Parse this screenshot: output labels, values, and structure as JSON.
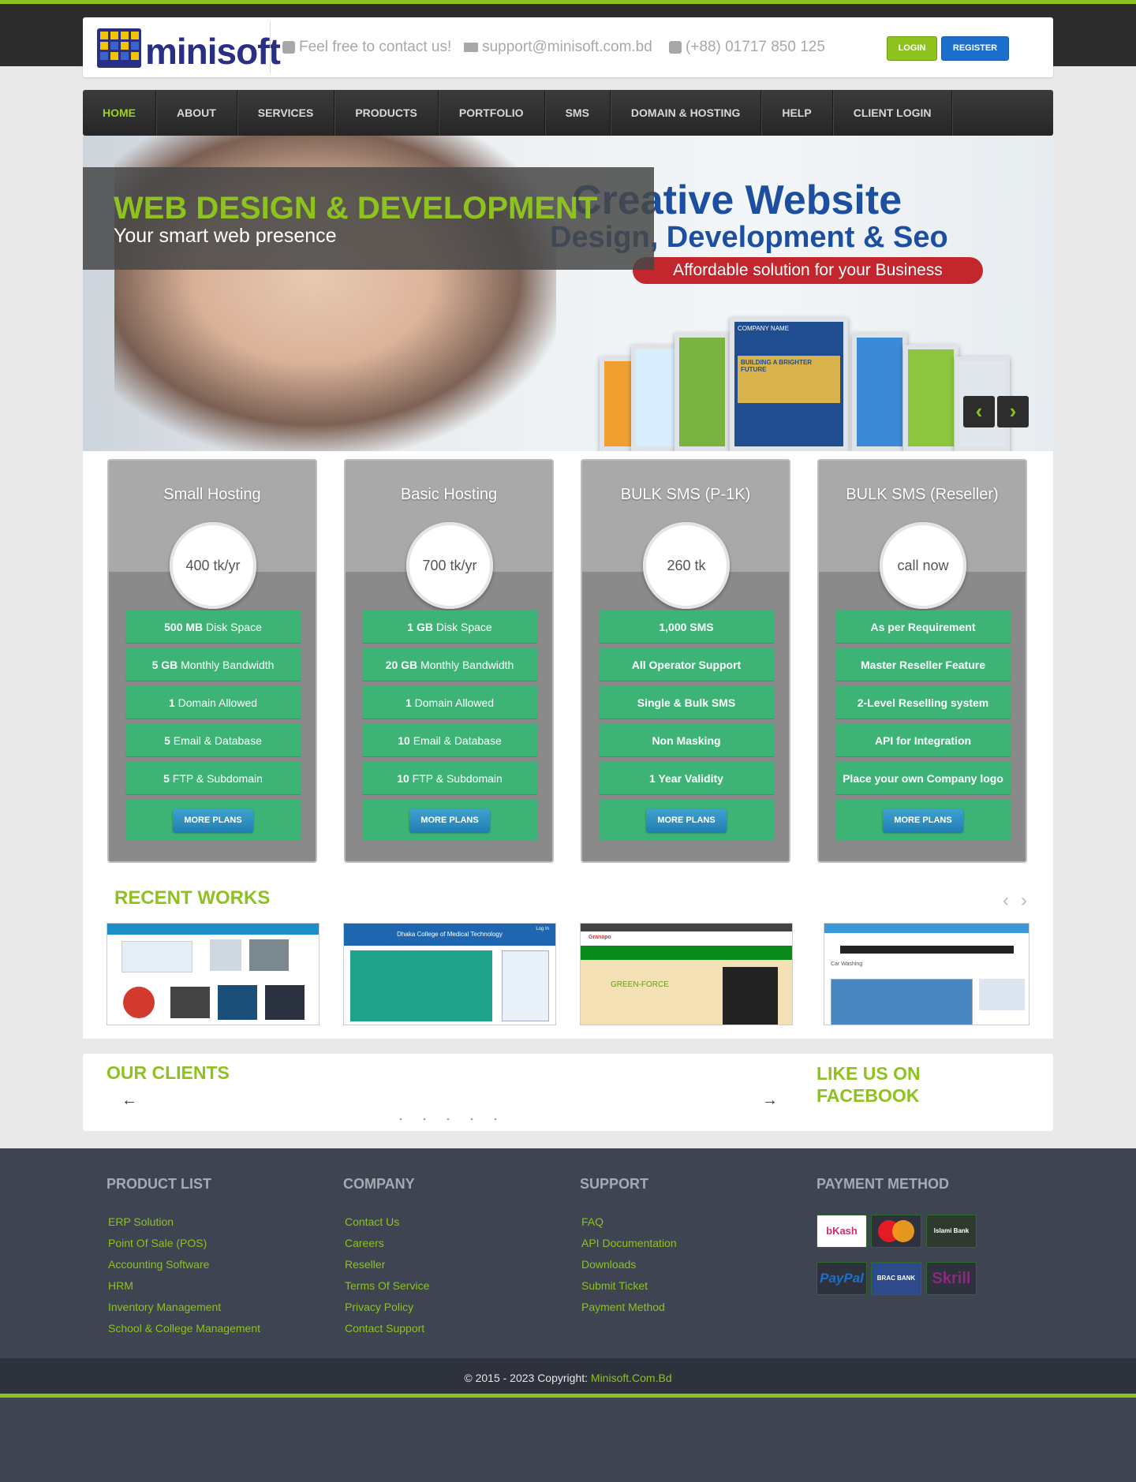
{
  "brand": {
    "name": "minisoft",
    "accent": "#8dc21f",
    "nav_bg": "#2b2b2b",
    "footer_bg": "#3e4452",
    "plan_green": "#3db475"
  },
  "header": {
    "contact_text": "Feel free to contact us!",
    "email": "support@minisoft.com.bd",
    "phone": "(+88) 01717 850 125",
    "login_label": "LOGIN",
    "register_label": "REGISTER"
  },
  "nav": {
    "items": [
      "HOME",
      "ABOUT",
      "SERVICES",
      "PRODUCTS",
      "PORTFOLIO",
      "SMS",
      "DOMAIN & HOSTING",
      "HELP",
      "CLIENT LOGIN"
    ],
    "active": "HOME"
  },
  "hero": {
    "caption_title": "WEB DESIGN & DEVELOPMENT",
    "caption_sub": "Your smart web presence",
    "banner_line1": "Creative Website",
    "banner_line2": "Design, Development & Seo",
    "banner_pill": "Affordable solution for your Business",
    "screen_text": "COMPANY NAME",
    "screen_text2": "BUILDING A BRIGHTER FUTURE",
    "prev_icon": "chevron-left-icon",
    "next_icon": "chevron-right-icon"
  },
  "plans": [
    {
      "title": "Small Hosting",
      "price": "400 tk/yr",
      "features": [
        [
          "500 MB",
          " Disk Space"
        ],
        [
          "5 GB",
          " Monthly Bandwidth"
        ],
        [
          "1",
          " Domain Allowed"
        ],
        [
          "5",
          " Email & Database"
        ],
        [
          "5",
          " FTP & Subdomain"
        ]
      ],
      "button": "MORE PLANS"
    },
    {
      "title": "Basic Hosting",
      "price": "700 tk/yr",
      "features": [
        [
          "1 GB",
          " Disk Space"
        ],
        [
          "20 GB",
          " Monthly Bandwidth"
        ],
        [
          "1",
          " Domain Allowed"
        ],
        [
          "10",
          " Email & Database"
        ],
        [
          "10",
          " FTP & Subdomain"
        ]
      ],
      "button": "MORE PLANS"
    },
    {
      "title": "BULK SMS (P-1K)",
      "price": "260 tk",
      "features": [
        [
          "1,000 SMS",
          ""
        ],
        [
          "All Operator Support",
          ""
        ],
        [
          "Single & Bulk SMS",
          ""
        ],
        [
          "Non Masking",
          ""
        ],
        [
          "1 Year Validity",
          ""
        ]
      ],
      "button": "MORE PLANS"
    },
    {
      "title": "BULK SMS (Reseller)",
      "price": "call now",
      "features": [
        [
          "As per Requirement",
          ""
        ],
        [
          "Master Reseller Feature",
          ""
        ],
        [
          "2-Level Reselling system",
          ""
        ],
        [
          "API for Integration",
          ""
        ],
        [
          "Place your own Company logo",
          ""
        ]
      ],
      "button": "MORE PLANS"
    }
  ],
  "recent_works": {
    "title": "RECENT WORKS",
    "items": [
      {
        "caption": ""
      },
      {
        "caption": "Dhaka College of Medical Technology",
        "login": "Log In"
      },
      {
        "caption": "GREEN-FORCE",
        "brand": "Granapo"
      },
      {
        "caption": "Car Washing"
      }
    ]
  },
  "clients": {
    "title": "OUR CLIENTS",
    "prev": "←",
    "next": "→",
    "facebook_title": "LIKE US ON FACEBOOK"
  },
  "footer": {
    "columns": [
      {
        "title": "PRODUCT LIST",
        "links": [
          "ERP Solution",
          "Point Of Sale (POS)",
          "Accounting Software",
          "HRM",
          "Inventory Management",
          "School & College Management"
        ]
      },
      {
        "title": "COMPANY",
        "links": [
          "Contact Us",
          "Careers",
          "Reseller",
          "Terms Of Service",
          "Privacy Policy",
          "Contact Support"
        ]
      },
      {
        "title": "SUPPORT",
        "links": [
          "FAQ",
          "API Documentation",
          "Downloads",
          "Submit Ticket",
          "Payment Method"
        ]
      },
      {
        "title": "PAYMENT METHOD",
        "links": []
      }
    ],
    "payments": [
      "bKash",
      "MasterCard",
      "Islami Bank",
      "PayPal",
      "BRAC BANK",
      "Skrill"
    ],
    "copyright": "© 2015 - 2023 Copyright: ",
    "copyright_link": "Minisoft.Com.Bd"
  }
}
